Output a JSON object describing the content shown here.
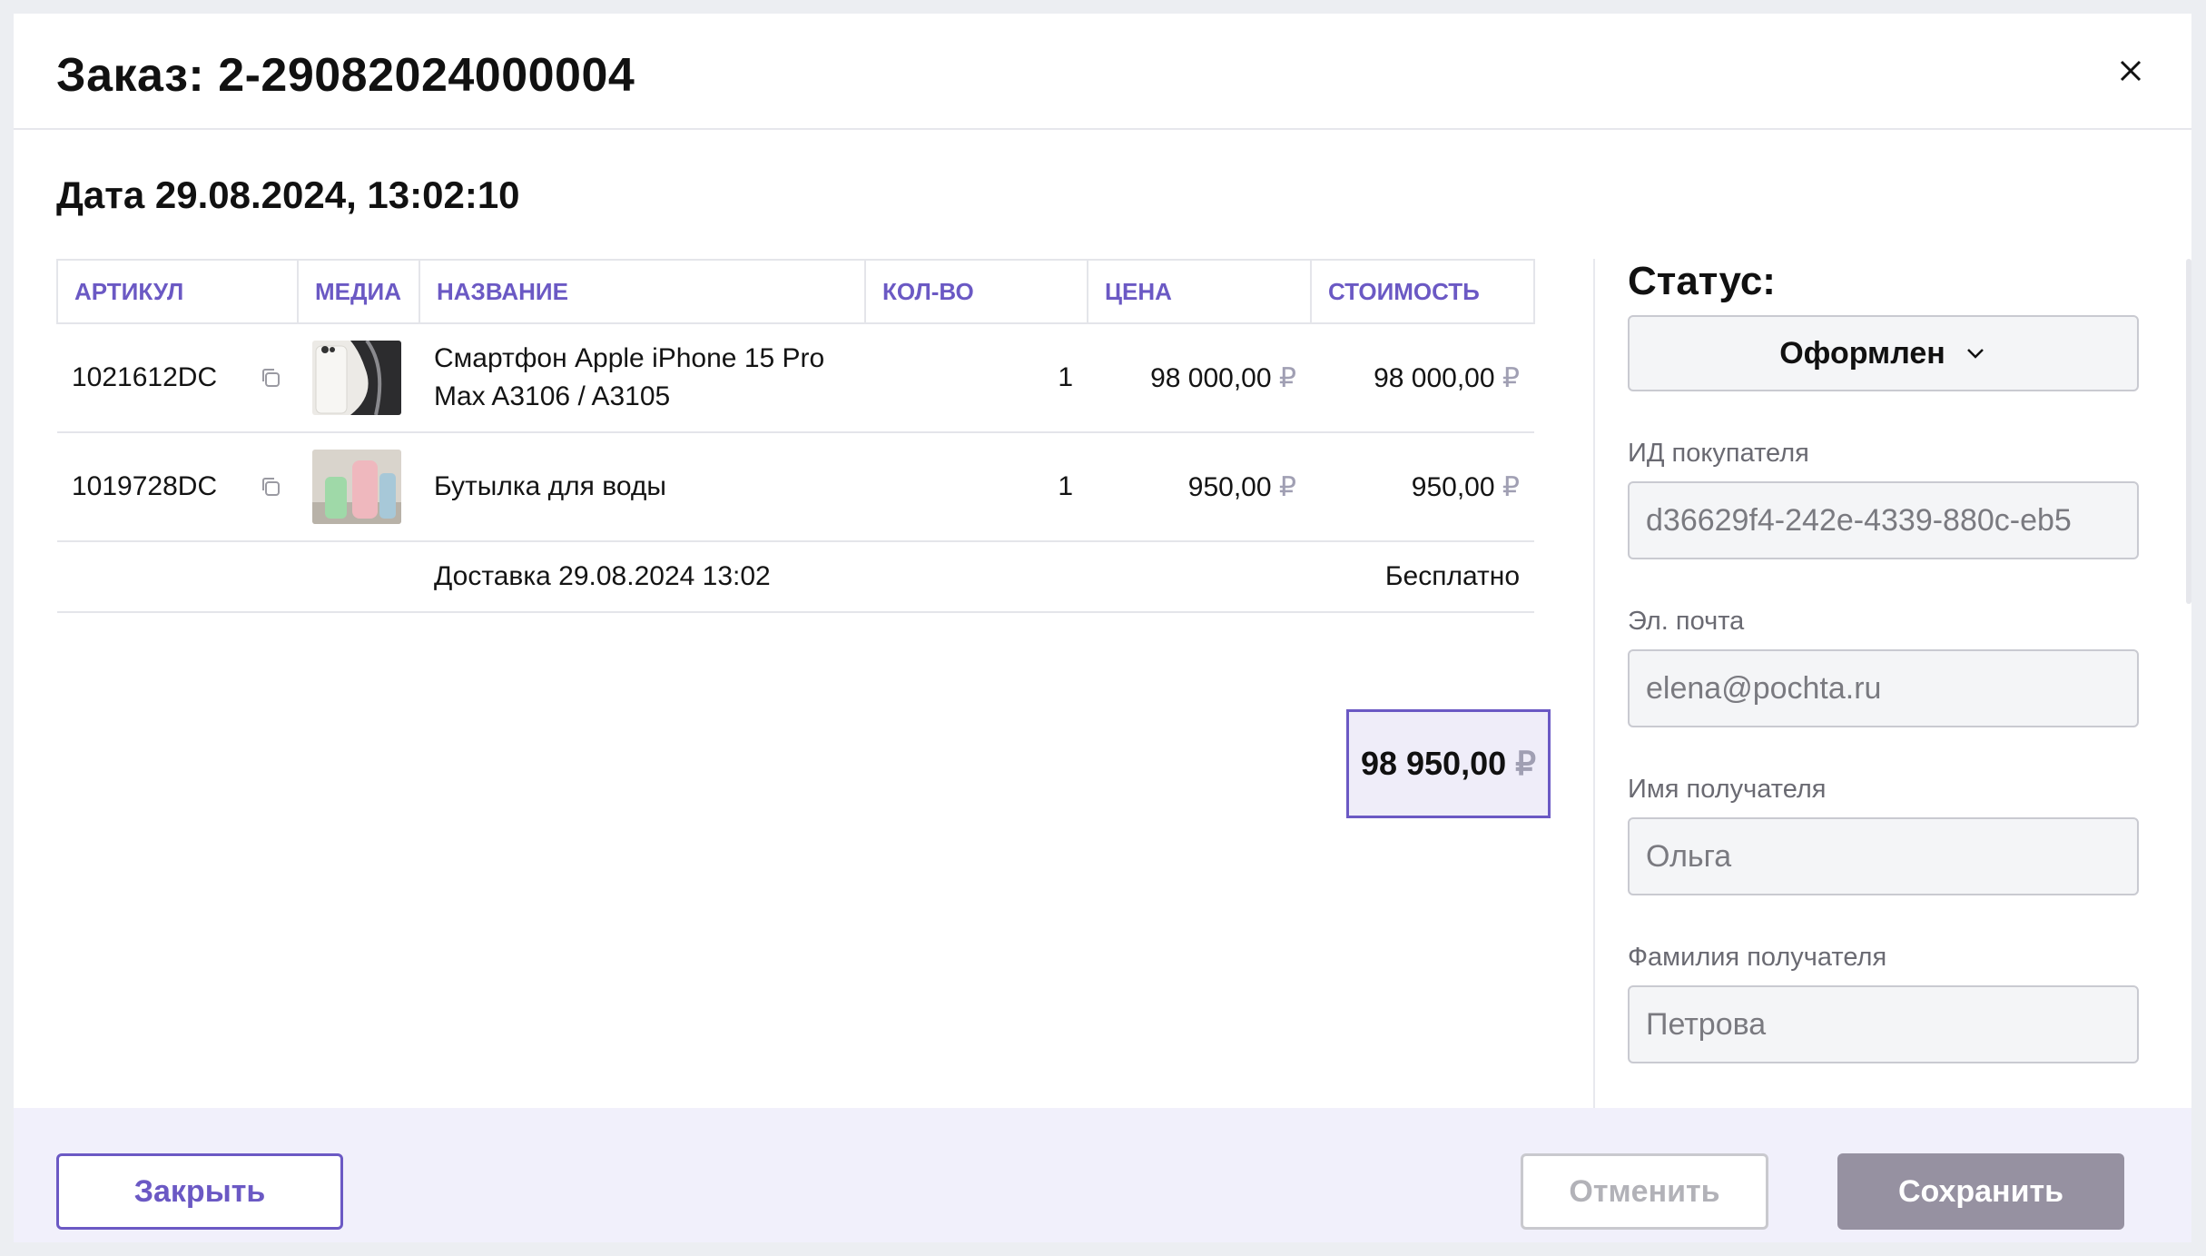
{
  "modal": {
    "title": "Заказ: 2-29082024000004",
    "date": "Дата 29.08.2024, 13:02:10"
  },
  "table": {
    "headers": {
      "sku": "АРТИКУЛ",
      "media": "МЕДИА",
      "name": "НАЗВАНИЕ",
      "qty": "КОЛ-ВО",
      "price": "ЦЕНА",
      "cost": "СТОИМОСТЬ"
    },
    "rows": [
      {
        "sku": "1021612DC",
        "media_icon": "phone-thumbnail",
        "name": "Смартфон Apple iPhone 15 Pro Max A3106 / A3105",
        "qty": "1",
        "price": "98 000,00",
        "cost": "98 000,00"
      },
      {
        "sku": "1019728DC",
        "media_icon": "bottle-thumbnail",
        "name": "Бутылка для воды",
        "qty": "1",
        "price": "950,00",
        "cost": "950,00"
      }
    ],
    "delivery": {
      "label": "Доставка 29.08.2024 13:02",
      "value": "Бесплатно"
    },
    "currency": "₽"
  },
  "total": "98 950,00",
  "sidebar": {
    "status_label": "Статус:",
    "status_value": "Оформлен",
    "fields": {
      "buyer_id": {
        "label": "ИД покупателя",
        "value": "d36629f4-242e-4339-880c-eb5"
      },
      "email": {
        "label": "Эл. почта",
        "value": "elena@pochta.ru"
      },
      "first_name": {
        "label": "Имя получателя",
        "value": "Ольга"
      },
      "last_name": {
        "label": "Фамилия получателя",
        "value": "Петрова"
      }
    }
  },
  "footer": {
    "close_label": "Закрыть",
    "cancel_label": "Отменить",
    "save_label": "Сохранить"
  },
  "colors": {
    "accent": "#6b59c4",
    "total_bg": "#efedf9",
    "save_bg": "#9691a1",
    "footer_bg": "#f1f0fb"
  }
}
